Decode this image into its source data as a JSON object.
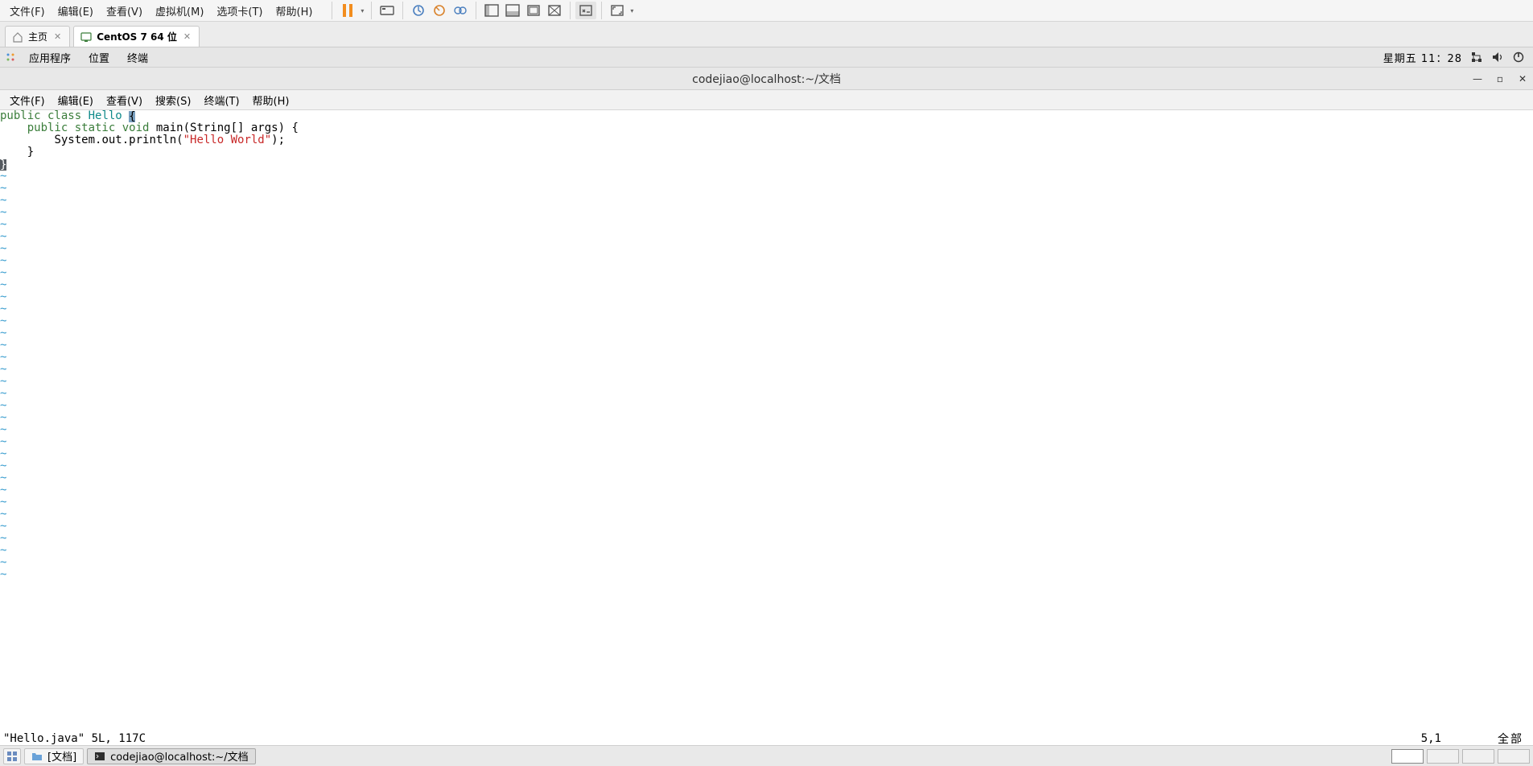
{
  "vmware_menu": {
    "file": "文件(F)",
    "edit": "编辑(E)",
    "view": "查看(V)",
    "vm": "虚拟机(M)",
    "tabs": "选项卡(T)",
    "help": "帮助(H)"
  },
  "vmware_tabs": {
    "home": "主页",
    "centos": "CentOS 7 64 位"
  },
  "gnome_top": {
    "applications": "应用程序",
    "places": "位置",
    "terminal": "终端",
    "clock": "星期五 11：28"
  },
  "term_title": "codejiao@localhost:~/文档",
  "term_menu": {
    "file": "文件(F)",
    "edit": "编辑(E)",
    "view": "查看(V)",
    "search": "搜索(S)",
    "terminal": "终端(T)",
    "help": "帮助(H)"
  },
  "vim": {
    "code": {
      "l1_kw": "public class",
      "l1_name": " Hello ",
      "l1_brace": "{",
      "l2_indent": "    ",
      "l2_kw": "public static void",
      "l2_rest": " main(String[] args) {",
      "l3_indent": "        ",
      "l3_call": "System.out.println(",
      "l3_str": "\"Hello World\"",
      "l3_end": ");",
      "l4": "    }",
      "l5": "}"
    },
    "status_left": "\"Hello.java\" 5L, 117C",
    "status_pos": "5,1",
    "status_right": "全部"
  },
  "taskbar": {
    "docs": "[文档]",
    "term": "codejiao@localhost:~/文档"
  }
}
